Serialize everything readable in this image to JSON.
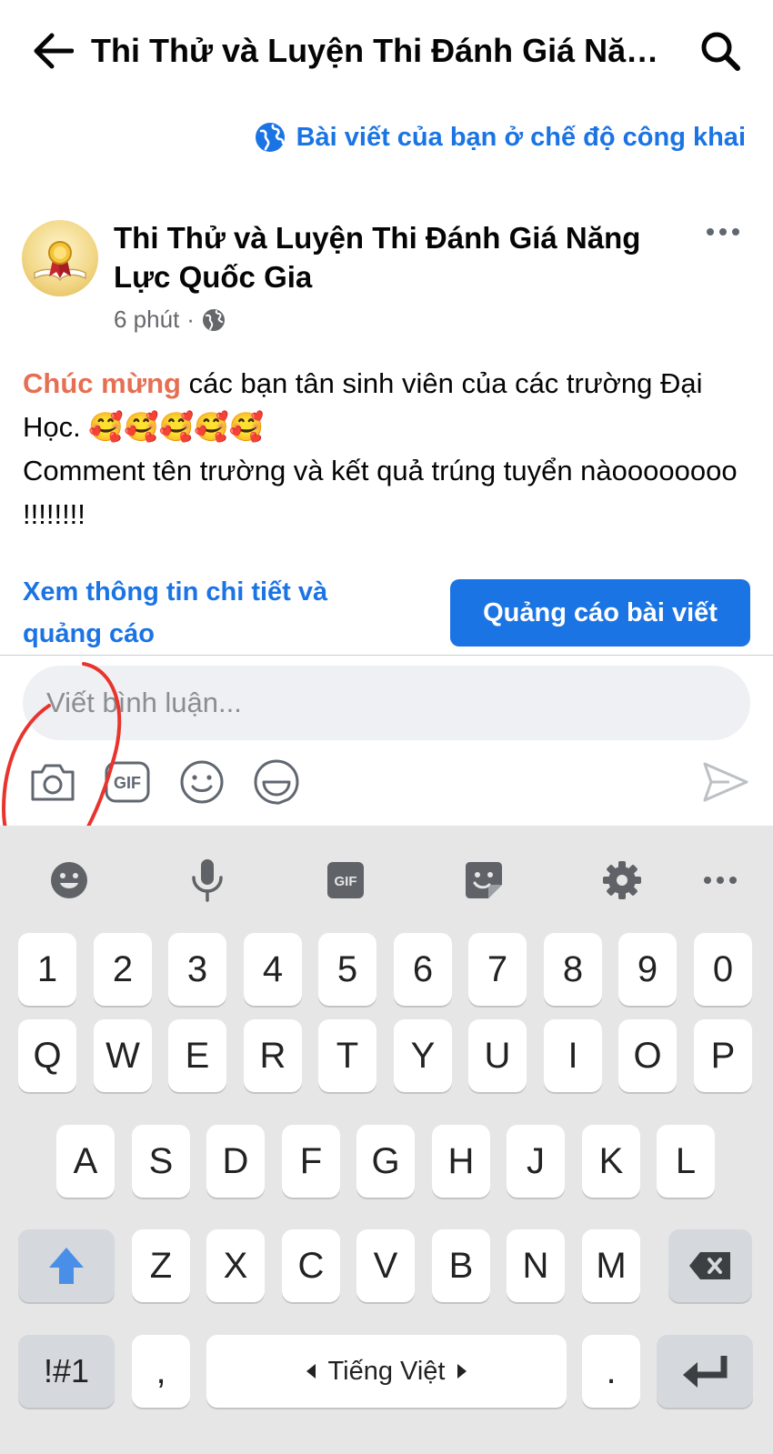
{
  "header": {
    "title": "Thi Thử và Luyện Thi Đánh Giá Năng Lực Quốc Gia",
    "back_icon": "arrow-left-icon",
    "search_icon": "search-icon"
  },
  "privacy_note": "Bài viết của bạn ở chế độ công khai",
  "post": {
    "author": "Thi Thử và Luyện Thi Đánh Giá Năng Lực Quốc Gia",
    "time": "6 phút",
    "separator": "·",
    "highlight": "Chúc mừng",
    "text_1": " các bạn tân sinh viên của các trường Đại Học. ",
    "emojis": "🥰🥰🥰🥰🥰",
    "text_2": "Comment tên trường và kết quả trúng tuyển nàoooooooo !!!!!!!!"
  },
  "actions": {
    "details_link": "Xem thông tin chi tiết và quảng cáo",
    "boost_button": "Quảng cáo bài viết"
  },
  "comment": {
    "placeholder": "Viết bình luận...",
    "gif_label": "GIF"
  },
  "keyboard": {
    "toolbar_gif": "GIF",
    "numbers": [
      "1",
      "2",
      "3",
      "4",
      "5",
      "6",
      "7",
      "8",
      "9",
      "0"
    ],
    "row1": [
      "Q",
      "W",
      "E",
      "R",
      "T",
      "Y",
      "U",
      "I",
      "O",
      "P"
    ],
    "row2": [
      "A",
      "S",
      "D",
      "F",
      "G",
      "H",
      "J",
      "K",
      "L"
    ],
    "row3": [
      "Z",
      "X",
      "C",
      "V",
      "B",
      "N",
      "M"
    ],
    "symbols": "!#1",
    "comma": ",",
    "space": "Tiếng Việt",
    "period": "."
  },
  "colors": {
    "accent": "#1b74e4",
    "highlight": "#e66f53",
    "shift": "#4a8fe7",
    "annotation": "#e8342c"
  }
}
